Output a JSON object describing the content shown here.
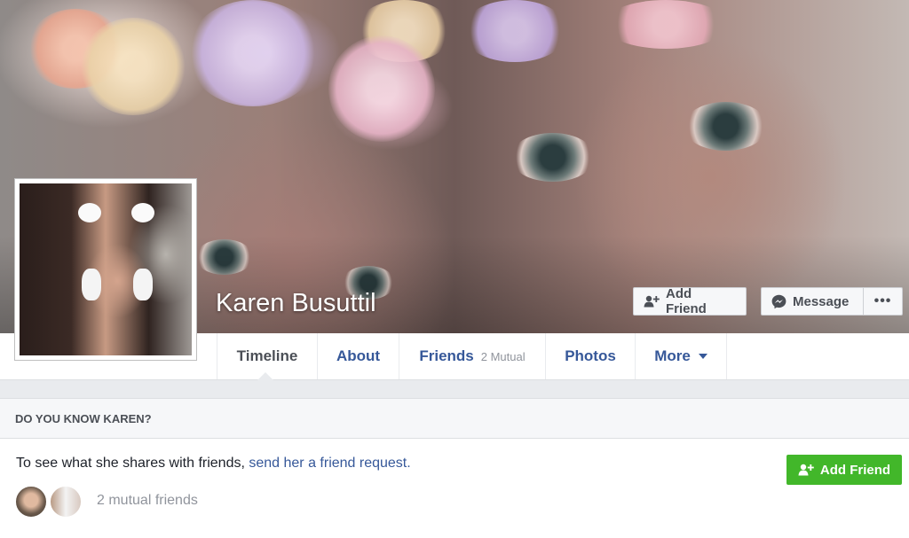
{
  "profile": {
    "name": "Karen Busuttil"
  },
  "cover_actions": {
    "add_friend": "Add Friend",
    "message": "Message",
    "more": "•••"
  },
  "tabs": [
    {
      "label": "Timeline",
      "active": true
    },
    {
      "label": "About"
    },
    {
      "label": "Friends",
      "sub": "2 Mutual"
    },
    {
      "label": "Photos"
    },
    {
      "label": "More"
    }
  ],
  "know_card": {
    "header": "DO YOU KNOW KAREN?",
    "text_prefix": "To see what she shares with friends,",
    "link": "send her a friend request.",
    "button": "Add Friend",
    "mutual": "2 mutual friends"
  },
  "colors": {
    "link_blue": "#365899",
    "green": "#42b72a",
    "background": "#e9ebee"
  },
  "icons": {
    "add_friend": "person-plus-icon",
    "message": "messenger-icon",
    "more": "ellipsis-icon",
    "more_tab": "caret-down-icon"
  }
}
